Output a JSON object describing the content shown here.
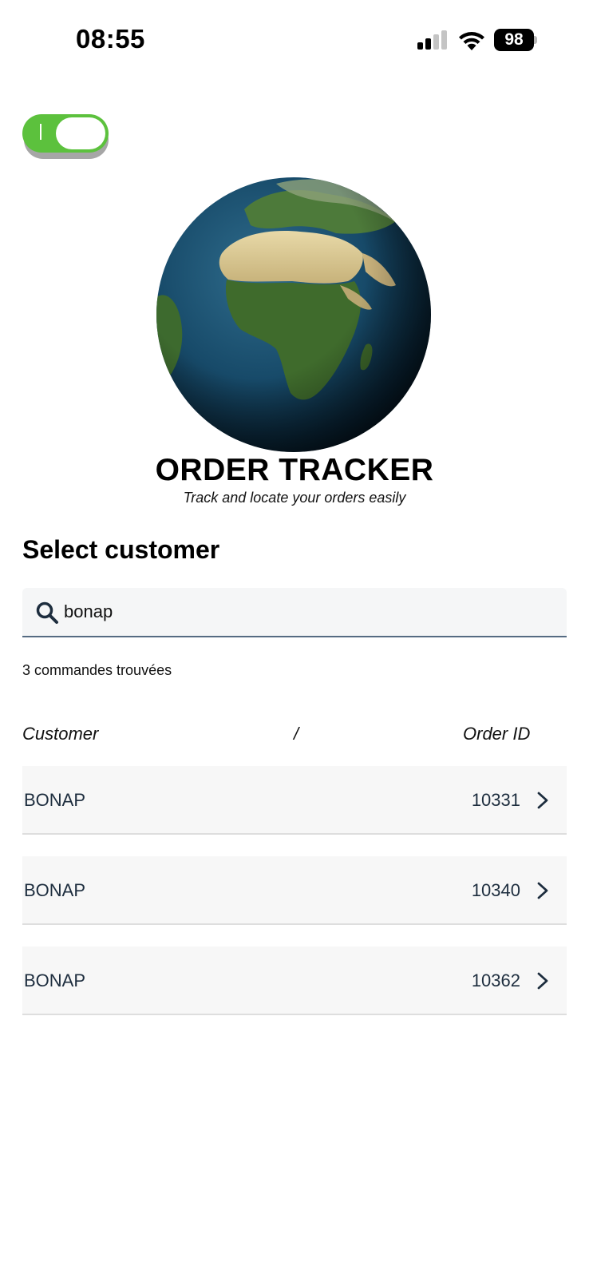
{
  "status_bar": {
    "time": "08:55",
    "battery": "98",
    "icons": [
      "cellular-signal-icon",
      "wifi-icon",
      "battery-icon"
    ]
  },
  "toggle": {
    "state": "on",
    "mark": "I",
    "color": "#5cc13d"
  },
  "hero": {
    "image": "globe-image",
    "title": "ORDER TRACKER",
    "subtitle": "Track and locate your orders easily"
  },
  "section": {
    "title": "Select customer"
  },
  "search": {
    "value": "bonap",
    "icon": "search-icon"
  },
  "results": {
    "count_text": "3 commandes trouvées"
  },
  "table": {
    "headers": {
      "customer": "Customer",
      "separator": "/",
      "order_id": "Order ID"
    },
    "rows": [
      {
        "customer": "BONAP",
        "order_id": "10331"
      },
      {
        "customer": "BONAP",
        "order_id": "10340"
      },
      {
        "customer": "BONAP",
        "order_id": "10362"
      }
    ]
  },
  "colors": {
    "accent_green": "#5cc13d",
    "search_underline": "#556b82",
    "row_background": "#f7f7f7",
    "text_dark_blue": "#1d2d3e"
  }
}
